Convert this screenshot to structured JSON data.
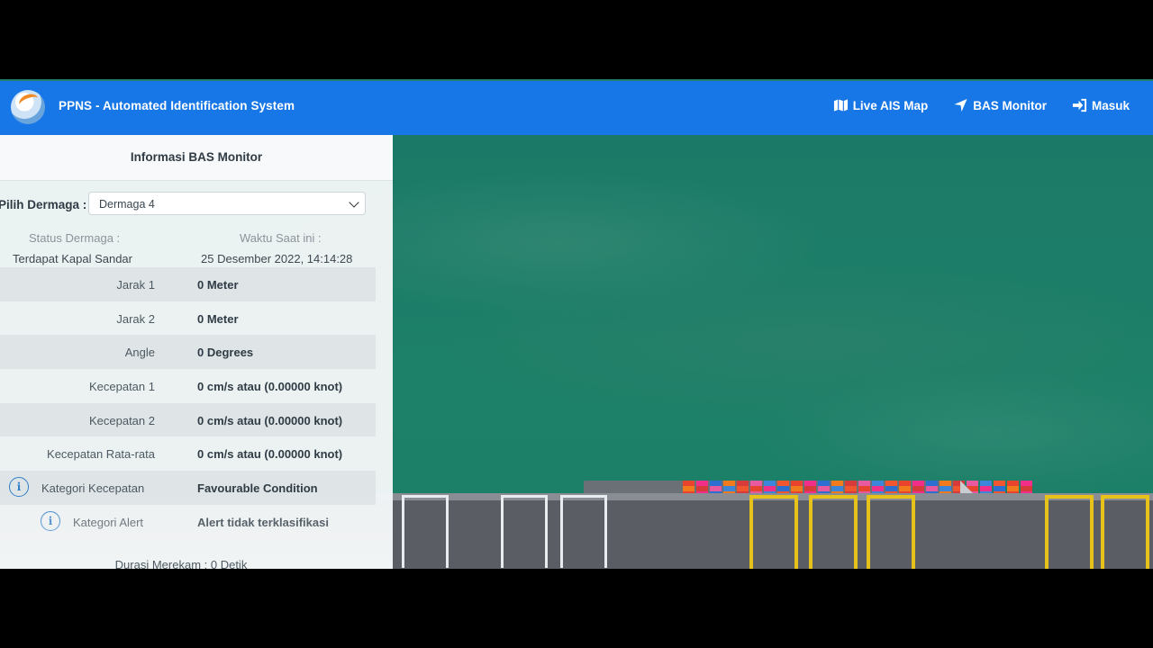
{
  "navbar": {
    "brand": "PPNS - Automated Identification System",
    "items": [
      {
        "label": "Live AIS Map",
        "icon": "map-icon"
      },
      {
        "label": "BAS Monitor",
        "icon": "location-arrow-icon"
      },
      {
        "label": "Masuk",
        "icon": "sign-in-icon"
      }
    ]
  },
  "panel": {
    "title": "Informasi BAS Monitor",
    "select_label": "Pilih Dermaga :",
    "select_value": "Dermaga 4",
    "status_label": "Status Dermaga :",
    "status_value": "Terdapat Kapal Sandar",
    "time_label": "Waktu Saat ini :",
    "time_value": "25 Desember 2022, 14:14:28",
    "rows": [
      {
        "key": "Jarak 1",
        "value": "0 Meter"
      },
      {
        "key": "Jarak 2",
        "value": "0 Meter"
      },
      {
        "key": "Angle",
        "value": "0 Degrees"
      },
      {
        "key": "Kecepatan 1",
        "value": "0 cm/s atau (0.00000 knot)"
      },
      {
        "key": "Kecepatan 2",
        "value": "0 cm/s atau (0.00000 knot)"
      },
      {
        "key": "Kecepatan Rata-rata",
        "value": "0 cm/s atau (0.00000 knot)"
      },
      {
        "key": "Kategori Kecepatan",
        "value": "Favourable Condition"
      },
      {
        "key": "Kategori Alert",
        "value": "Alert tidak terklasifikasi"
      }
    ],
    "info_glyph": "i",
    "duration": "Durasi Merekam : 0 Detik"
  },
  "colors": {
    "navbar": "#1877e6",
    "sea": "#1d8068"
  }
}
